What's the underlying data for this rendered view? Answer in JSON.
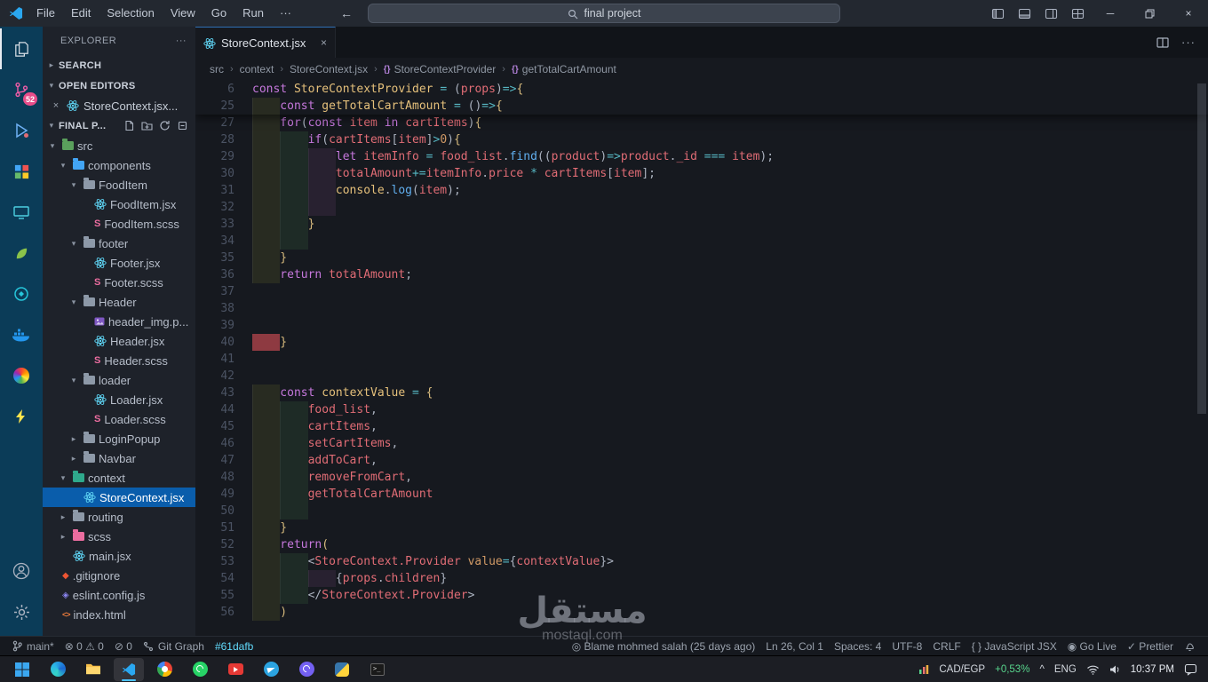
{
  "title_bar": {
    "menus": [
      "File",
      "Edit",
      "Selection",
      "View",
      "Go",
      "Run",
      "···"
    ],
    "nav_back": "←",
    "nav_forward": "→",
    "search": {
      "value": "final project"
    },
    "window": {
      "minimize": "─",
      "close": "×"
    }
  },
  "activity_bar": {
    "items": [
      {
        "name": "explorer",
        "icon": "files-icon",
        "color": "#d8dee6",
        "active": true
      },
      {
        "name": "source-control",
        "icon": "source-control-icon",
        "color": "#ef5da8",
        "badge": "52"
      },
      {
        "name": "run-debug",
        "icon": "run-debug-icon",
        "color": "#6fb1f5"
      },
      {
        "name": "extensions",
        "icon": "extensions-icon",
        "color": "#c792ea"
      },
      {
        "name": "remote-explorer",
        "icon": "monitor-icon",
        "color": "#4dd0e1"
      },
      {
        "name": "material-theme",
        "icon": "leaf-icon",
        "color": "#8bc34a"
      },
      {
        "name": "gitlens",
        "icon": "gitlens-icon",
        "color": "#26c6da"
      },
      {
        "name": "docker",
        "icon": "docker-icon",
        "color": "#2396ed"
      },
      {
        "name": "settings-sync",
        "icon": "color-wheel-icon",
        "color": "#ffa726"
      },
      {
        "name": "thunder-client",
        "icon": "lightning-icon",
        "color": "#ffe44d"
      }
    ],
    "bottom": [
      {
        "name": "account",
        "icon": "account-icon",
        "color": "#aab2c0"
      },
      {
        "name": "settings",
        "icon": "gear-icon",
        "color": "#aab2c0"
      }
    ]
  },
  "sidebar": {
    "title": "EXPLORER",
    "title_more": "···",
    "search_section": "SEARCH",
    "open_editors": {
      "label": "OPEN EDITORS",
      "items": [
        {
          "close": "×",
          "icon": "react-icon",
          "label": "StoreContext.jsx..."
        }
      ]
    },
    "workspace": {
      "label": "FINAL P...",
      "actions": [
        "new-file-icon",
        "new-folder-icon",
        "refresh-icon",
        "collapse-all-icon"
      ]
    },
    "tree": [
      {
        "label": "src",
        "level": 1,
        "icon": "folder-icon",
        "color": "#5aa05c",
        "expanded": true
      },
      {
        "label": "components",
        "level": 2,
        "icon": "folder-icon",
        "color": "#42a5f5",
        "expanded": true
      },
      {
        "label": "FoodItem",
        "level": 3,
        "icon": "folder-icon",
        "color": "#8d99a8",
        "expanded": true
      },
      {
        "label": "FoodItem.jsx",
        "level": 4,
        "icon": "react-icon"
      },
      {
        "label": "FoodItem.scss",
        "level": 4,
        "icon": "sass-icon"
      },
      {
        "label": "footer",
        "level": 3,
        "icon": "folder-icon",
        "color": "#8d99a8",
        "expanded": true
      },
      {
        "label": "Footer.jsx",
        "level": 4,
        "icon": "react-icon"
      },
      {
        "label": "Footer.scss",
        "level": 4,
        "icon": "sass-icon"
      },
      {
        "label": "Header",
        "level": 3,
        "icon": "folder-icon",
        "color": "#8d99a8",
        "expanded": true
      },
      {
        "label": "header_img.p...",
        "level": 4,
        "icon": "image-icon"
      },
      {
        "label": "Header.jsx",
        "level": 4,
        "icon": "react-icon"
      },
      {
        "label": "Header.scss",
        "level": 4,
        "icon": "sass-icon"
      },
      {
        "label": "loader",
        "level": 3,
        "icon": "folder-icon",
        "color": "#8d99a8",
        "expanded": true
      },
      {
        "label": "Loader.jsx",
        "level": 4,
        "icon": "react-icon"
      },
      {
        "label": "Loader.scss",
        "level": 4,
        "icon": "sass-icon"
      },
      {
        "label": "LoginPopup",
        "level": 3,
        "icon": "folder-icon",
        "color": "#8d99a8",
        "expanded": false
      },
      {
        "label": "Navbar",
        "level": 3,
        "icon": "folder-icon",
        "color": "#8d99a8",
        "expanded": false
      },
      {
        "label": "context",
        "level": 2,
        "icon": "folder-icon",
        "color": "#2fa98c",
        "expanded": true
      },
      {
        "label": "StoreContext.jsx",
        "level": 3,
        "icon": "react-icon",
        "selected": true
      },
      {
        "label": "routing",
        "level": 2,
        "icon": "folder-icon",
        "color": "#8d99a8",
        "expanded": false
      },
      {
        "label": "scss",
        "level": 2,
        "icon": "folder-icon",
        "color": "#ec6da0",
        "expanded": false
      },
      {
        "label": "main.jsx",
        "level": 2,
        "icon": "react-icon"
      },
      {
        "label": ".gitignore",
        "level": 1,
        "icon": "git-icon"
      },
      {
        "label": "eslint.config.js",
        "level": 1,
        "icon": "eslint-icon"
      },
      {
        "label": "index.html",
        "level": 1,
        "icon": "html-icon"
      }
    ]
  },
  "editor": {
    "tab": {
      "icon": "react-icon",
      "label": "StoreContext.jsx",
      "close": "×"
    },
    "tab_actions": [
      "split-editor-icon",
      "ellipsis-icon"
    ],
    "breadcrumb_sep": "›",
    "breadcrumbs": [
      {
        "label": "src"
      },
      {
        "label": "context"
      },
      {
        "label": "StoreContext.jsx"
      },
      {
        "label": "StoreContextProvider",
        "icon": "symbol-method-icon"
      },
      {
        "label": "getTotalCartAmount",
        "icon": "symbol-method-icon"
      }
    ],
    "code": {
      "sticky": [
        {
          "n": "6",
          "ind": 0,
          "t": [
            [
              "kw",
              "const "
            ],
            [
              "fn",
              "StoreContextProvider "
            ],
            [
              "op",
              "= "
            ],
            [
              "pu",
              "("
            ],
            [
              "vr",
              "props"
            ],
            [
              "pu",
              ")"
            ],
            [
              "op",
              "=>"
            ],
            [
              "br",
              "{"
            ]
          ]
        },
        {
          "n": "25",
          "ind": 1,
          "t": [
            [
              "kw",
              "const "
            ],
            [
              "fn",
              "getTotalCartAmount "
            ],
            [
              "op",
              "= "
            ],
            [
              "pu",
              "()"
            ],
            [
              "op",
              "=>"
            ],
            [
              "br",
              "{"
            ]
          ]
        }
      ],
      "lines": [
        {
          "n": "27",
          "ind": 1,
          "t": [
            [
              "kw",
              "for"
            ],
            [
              "pu",
              "("
            ],
            [
              "kw",
              "const "
            ],
            [
              "vr",
              "item "
            ],
            [
              "kw",
              "in "
            ],
            [
              "vr",
              "cartItems"
            ],
            [
              "pu",
              ")"
            ],
            [
              "br",
              "{"
            ]
          ]
        },
        {
          "n": "28",
          "ind": 2,
          "t": [
            [
              "kw",
              "if"
            ],
            [
              "pu",
              "("
            ],
            [
              "vr",
              "cartItems"
            ],
            [
              "pu",
              "["
            ],
            [
              "vr",
              "item"
            ],
            [
              "pu",
              "]"
            ],
            [
              "op",
              ">"
            ],
            [
              "nu",
              "0"
            ],
            [
              "pu",
              ")"
            ],
            [
              "br",
              "{"
            ]
          ]
        },
        {
          "n": "29",
          "ind": 3,
          "t": [
            [
              "kw",
              "let "
            ],
            [
              "vr",
              "itemInfo "
            ],
            [
              "op",
              "= "
            ],
            [
              "vr",
              "food_list"
            ],
            [
              "pu",
              "."
            ],
            [
              "fb",
              "find"
            ],
            [
              "pu",
              "(("
            ],
            [
              "vr",
              "product"
            ],
            [
              "pu",
              ")"
            ],
            [
              "op",
              "=>"
            ],
            [
              "vr",
              "product"
            ],
            [
              "pu",
              "."
            ],
            [
              "vr",
              "_id "
            ],
            [
              "op",
              "=== "
            ],
            [
              "vr",
              "item"
            ],
            [
              "pu",
              ");"
            ]
          ]
        },
        {
          "n": "30",
          "ind": 3,
          "t": [
            [
              "vr",
              "totalAmount"
            ],
            [
              "op",
              "+="
            ],
            [
              "vr",
              "itemInfo"
            ],
            [
              "pu",
              "."
            ],
            [
              "vr",
              "price "
            ],
            [
              "op",
              "* "
            ],
            [
              "vr",
              "cartItems"
            ],
            [
              "pu",
              "["
            ],
            [
              "vr",
              "item"
            ],
            [
              "pu",
              "];"
            ]
          ]
        },
        {
          "n": "31",
          "ind": 3,
          "t": [
            [
              "sp",
              "console"
            ],
            [
              "pu",
              "."
            ],
            [
              "fb",
              "log"
            ],
            [
              "pu",
              "("
            ],
            [
              "vr",
              "item"
            ],
            [
              "pu",
              ");"
            ]
          ]
        },
        {
          "n": "32",
          "ind": 3,
          "t": []
        },
        {
          "n": "33",
          "ind": 2,
          "t": [
            [
              "br",
              "}"
            ]
          ]
        },
        {
          "n": "34",
          "ind": 2,
          "t": []
        },
        {
          "n": "35",
          "ind": 1,
          "t": [
            [
              "br",
              "}"
            ]
          ]
        },
        {
          "n": "36",
          "ind": 1,
          "t": [
            [
              "kw",
              "return "
            ],
            [
              "vr",
              "totalAmount"
            ],
            [
              "pu",
              ";"
            ]
          ]
        },
        {
          "n": "37",
          "ind": 0,
          "t": []
        },
        {
          "n": "38",
          "ind": 0,
          "t": []
        },
        {
          "n": "39",
          "ind": 0,
          "t": []
        },
        {
          "n": "40",
          "ind": 1,
          "dec": "red",
          "t": [
            [
              "br",
              "}"
            ]
          ]
        },
        {
          "n": "41",
          "ind": 0,
          "t": []
        },
        {
          "n": "42",
          "ind": 0,
          "t": []
        },
        {
          "n": "43",
          "ind": 1,
          "t": [
            [
              "kw",
              "const "
            ],
            [
              "fn",
              "contextValue "
            ],
            [
              "op",
              "= "
            ],
            [
              "br",
              "{"
            ]
          ]
        },
        {
          "n": "44",
          "ind": 2,
          "t": [
            [
              "vr",
              "food_list"
            ],
            [
              "pu",
              ","
            ]
          ]
        },
        {
          "n": "45",
          "ind": 2,
          "t": [
            [
              "vr",
              "cartItems"
            ],
            [
              "pu",
              ","
            ]
          ]
        },
        {
          "n": "46",
          "ind": 2,
          "t": [
            [
              "vr",
              "setCartItems"
            ],
            [
              "pu",
              ","
            ]
          ]
        },
        {
          "n": "47",
          "ind": 2,
          "t": [
            [
              "vr",
              "addToCart"
            ],
            [
              "pu",
              ","
            ]
          ]
        },
        {
          "n": "48",
          "ind": 2,
          "t": [
            [
              "vr",
              "removeFromCart"
            ],
            [
              "pu",
              ","
            ]
          ]
        },
        {
          "n": "49",
          "ind": 2,
          "t": [
            [
              "vr",
              "getTotalCartAmount"
            ]
          ]
        },
        {
          "n": "50",
          "ind": 2,
          "t": []
        },
        {
          "n": "51",
          "ind": 1,
          "t": [
            [
              "br",
              "}"
            ]
          ]
        },
        {
          "n": "52",
          "ind": 1,
          "t": [
            [
              "kw",
              "return"
            ],
            [
              "br",
              "("
            ]
          ]
        },
        {
          "n": "53",
          "ind": 2,
          "t": [
            [
              "pu",
              "<"
            ],
            [
              "tg",
              "StoreContext.Provider "
            ],
            [
              "at",
              "value"
            ],
            [
              "op",
              "="
            ],
            [
              "pu",
              "{"
            ],
            [
              "vr",
              "contextValue"
            ],
            [
              "pu",
              "}>"
            ]
          ]
        },
        {
          "n": "54",
          "ind": 3,
          "t": [
            [
              "pu",
              "{"
            ],
            [
              "vr",
              "props"
            ],
            [
              "pu",
              "."
            ],
            [
              "vr",
              "children"
            ],
            [
              "pu",
              "}"
            ]
          ]
        },
        {
          "n": "55",
          "ind": 2,
          "t": [
            [
              "pu",
              "</"
            ],
            [
              "tg",
              "StoreContext.Provider"
            ],
            [
              "pu",
              ">"
            ]
          ]
        },
        {
          "n": "56",
          "ind": 1,
          "t": [
            [
              "br",
              ")"
            ]
          ]
        }
      ]
    }
  },
  "status_bar": {
    "left": [
      {
        "name": "git-branch",
        "icon": "branch-icon",
        "label": "main*"
      },
      {
        "name": "problems",
        "label": "⊗ 0  ⚠ 0"
      },
      {
        "name": "ports",
        "label": "⊘ 0"
      },
      {
        "name": "git-graph",
        "icon": "git-graph-icon",
        "label": "Git Graph"
      },
      {
        "name": "color-decorator",
        "label": "#61dafb",
        "color": "#61dafb"
      }
    ],
    "right": [
      {
        "name": "gitlens-blame",
        "label": "◎ Blame mohmed salah (25 days ago)"
      },
      {
        "name": "cursor-position",
        "label": "Ln 26, Col 1"
      },
      {
        "name": "indentation",
        "label": "Spaces: 4"
      },
      {
        "name": "encoding",
        "label": "UTF-8"
      },
      {
        "name": "eol",
        "label": "CRLF"
      },
      {
        "name": "language-mode",
        "label": "{ } JavaScript JSX"
      },
      {
        "name": "go-live",
        "label": "◉ Go Live"
      },
      {
        "name": "prettier",
        "label": "✓ Prettier"
      },
      {
        "name": "notifications",
        "icon": "bell-icon",
        "label": ""
      }
    ]
  },
  "taskbar": {
    "apps": [
      {
        "name": "start",
        "icon": "windows-icon"
      },
      {
        "name": "edge",
        "icon": "edge-icon"
      },
      {
        "name": "file-explorer",
        "icon": "folder-win-icon"
      },
      {
        "name": "vscode",
        "icon": "vscode-icon",
        "active": true
      },
      {
        "name": "chrome",
        "icon": "chrome-icon"
      },
      {
        "name": "whatsapp",
        "icon": "whatsapp-icon"
      },
      {
        "name": "media-red",
        "icon": "red-play-icon"
      },
      {
        "name": "telegram",
        "icon": "telegram-icon"
      },
      {
        "name": "viber",
        "icon": "viber-icon"
      },
      {
        "name": "python",
        "icon": "python-icon"
      },
      {
        "name": "terminal",
        "icon": "terminal-icon"
      }
    ],
    "tray": {
      "ticker": "CAD/EGP",
      "change": "+0,53%",
      "chevron": "^",
      "lang": "ENG",
      "time": "10:37 PM"
    }
  },
  "watermark": {
    "arabic": "مستقل",
    "domain": "mostaql.com"
  }
}
